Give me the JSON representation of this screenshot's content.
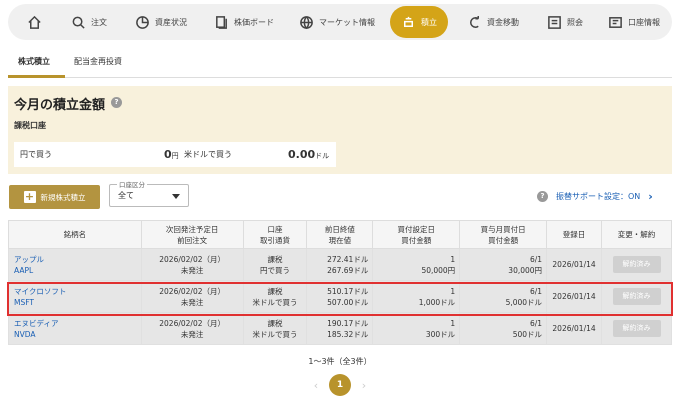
{
  "nav": {
    "home": "",
    "order": "注文",
    "assets": "資産状況",
    "board": "株価ボード",
    "market": "マーケット情報",
    "tsumitate": "積立",
    "transfer": "資金移動",
    "inquiry": "照会",
    "account": "口座情報"
  },
  "tabs": {
    "stock": "株式積立",
    "dividend": "配当金再投資"
  },
  "panel": {
    "title": "今月の積立金額",
    "account": "課税口座",
    "yen_label": "円で買う",
    "yen_amount": "0",
    "yen_unit": "円",
    "usd_label": "米ドルで買う",
    "usd_amount": "0.00",
    "usd_unit": "ドル"
  },
  "controls": {
    "new_button": "新規株式積立",
    "account_label": "口座区分",
    "account_value": "全て",
    "furikae_label": "振替サポート設定：ON"
  },
  "table": {
    "headers": [
      [
        "銘柄名"
      ],
      [
        "次回発注予定日",
        "前回注文"
      ],
      [
        "口座",
        "取引通貨"
      ],
      [
        "前日終値",
        "現在値"
      ],
      [
        "買付設定日",
        "買付金額"
      ],
      [
        "買与月買付日",
        "買付金額"
      ],
      [
        "登録日"
      ],
      [
        "変更・解約"
      ]
    ],
    "rows": [
      {
        "name": "アップル",
        "ticker": "AAPL",
        "next_date": "2026/02/02（月）",
        "last_order": "未発注",
        "account": "課税",
        "currency": "円で買う",
        "prev_close": "272.41ドル",
        "current": "267.69ドル",
        "set_day": "1",
        "set_amount": "50,000円",
        "bonus_day": "6/1",
        "bonus_amount": "30,000円",
        "registered": "2026/01/14",
        "action": "解約済み"
      },
      {
        "name": "マイクロソフト",
        "ticker": "MSFT",
        "next_date": "2026/02/02（月）",
        "last_order": "未発注",
        "account": "課税",
        "currency": "米ドルで買う",
        "prev_close": "510.17ドル",
        "current": "507.00ドル",
        "set_day": "1",
        "set_amount": "1,000ドル",
        "bonus_day": "6/1",
        "bonus_amount": "5,000ドル",
        "registered": "2026/01/14",
        "action": "解約済み"
      },
      {
        "name": "エヌビディア",
        "ticker": "NVDA",
        "next_date": "2026/02/02（月）",
        "last_order": "未発注",
        "account": "課税",
        "currency": "米ドルで買う",
        "prev_close": "190.17ドル",
        "current": "185.32ドル",
        "set_day": "1",
        "set_amount": "300ドル",
        "bonus_day": "6/1",
        "bonus_amount": "500ドル",
        "registered": "2026/01/14",
        "action": "解約済み"
      }
    ]
  },
  "paging": {
    "summary": "1〜3件（全3件）",
    "current_page": "1",
    "prev": "‹",
    "next": "›"
  },
  "colors": {
    "accent": "#d4a418",
    "highlight": "#e03030",
    "link": "#1a5fb4"
  }
}
